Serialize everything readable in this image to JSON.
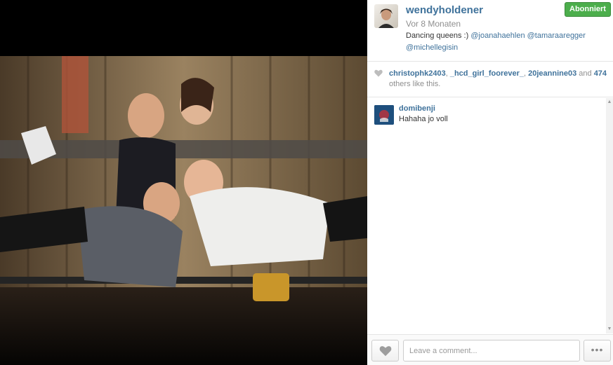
{
  "post": {
    "username": "wendyholdener",
    "time": "Vor 8 Monaten",
    "caption_text": "Dancing queens :) ",
    "mentions": [
      "@joanahaehlen",
      "@tamaraaregger",
      "@michellegisin"
    ],
    "follow_label": "Abonniert"
  },
  "likes": {
    "users": [
      "christophk2403",
      "_hcd_girl_foorever_",
      "20jeannine03"
    ],
    "and": "and",
    "count": "474",
    "suffix": "others like this."
  },
  "comments": [
    {
      "user": "domibenji",
      "text": "Hahaha jo voll"
    }
  ],
  "composer": {
    "placeholder": "Leave a comment...",
    "more_label": "•••"
  },
  "icons": {
    "like": "heart-icon",
    "more": "ellipsis-icon"
  },
  "colors": {
    "link": "#3f729b",
    "follow_green": "#4cae4c"
  }
}
